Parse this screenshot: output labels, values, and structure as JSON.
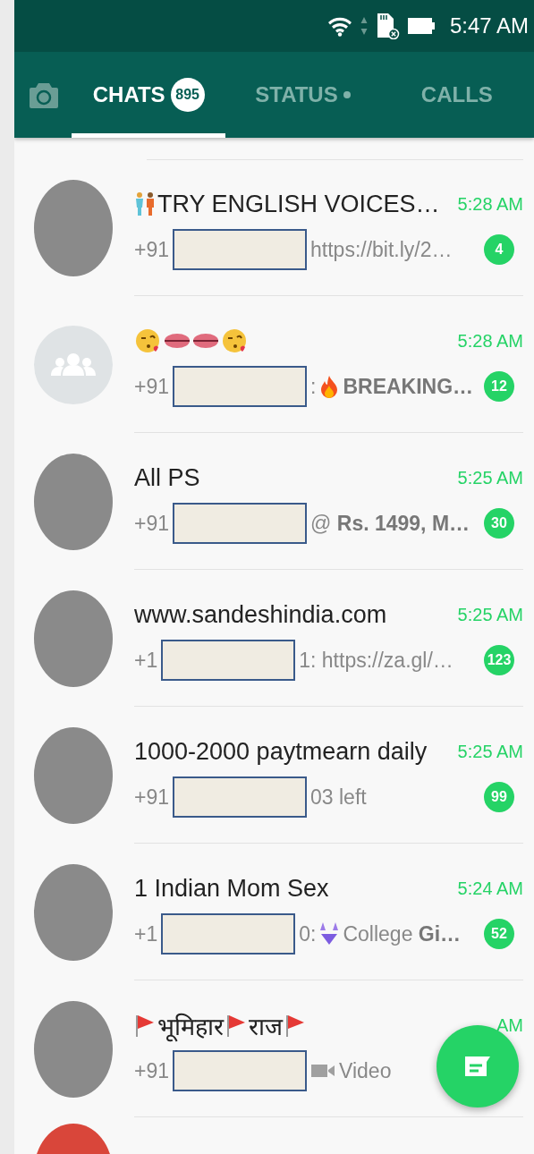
{
  "status_bar": {
    "time": "5:47 AM"
  },
  "tabs": [
    {
      "label": "CHATS",
      "selected": true,
      "count": "895",
      "dot": false
    },
    {
      "label": "STATUS",
      "selected": false,
      "dot": true
    },
    {
      "label": "CALLS",
      "selected": false,
      "dot": false
    }
  ],
  "chats": [
    {
      "kind": "photo",
      "name": "TRY ENGLISH VOICES…",
      "time": "5:28 AM",
      "preview_prefix": "+91",
      "preview_text": "https://bit.ly/2…",
      "unread": "4"
    },
    {
      "kind": "group",
      "time": "5:28 AM",
      "preview_prefix": "+91",
      "preview_text": ":",
      "preview_tail": "**BREAKING…**",
      "unread": "12"
    },
    {
      "kind": "photo",
      "name": "All PS",
      "time": "5:25 AM",
      "preview_prefix": "+91",
      "preview_text": "@ **Rs. 1499, M…**",
      "unread": "30"
    },
    {
      "kind": "photo",
      "name": "www.sandeshindia.com",
      "time": "5:25 AM",
      "preview_prefix": "+1",
      "preview_text": "1: https://za.gl/…",
      "unread": "123"
    },
    {
      "kind": "photo",
      "name": "1000-2000 paytmearn daily",
      "time": "5:25 AM",
      "preview_prefix": "+91",
      "preview_text": "03 left",
      "unread": "99"
    },
    {
      "kind": "photo",
      "name": "1 Indian Mom Sex",
      "time": "5:24 AM",
      "preview_prefix": "+1",
      "preview_text": "0:",
      "preview_tail": "College **Gi…**",
      "unread": "52"
    },
    {
      "kind": "photo",
      "name": "भूमिहार राज",
      "time": "AM",
      "preview_prefix": "+91",
      "preview_tail": "Video"
    }
  ]
}
